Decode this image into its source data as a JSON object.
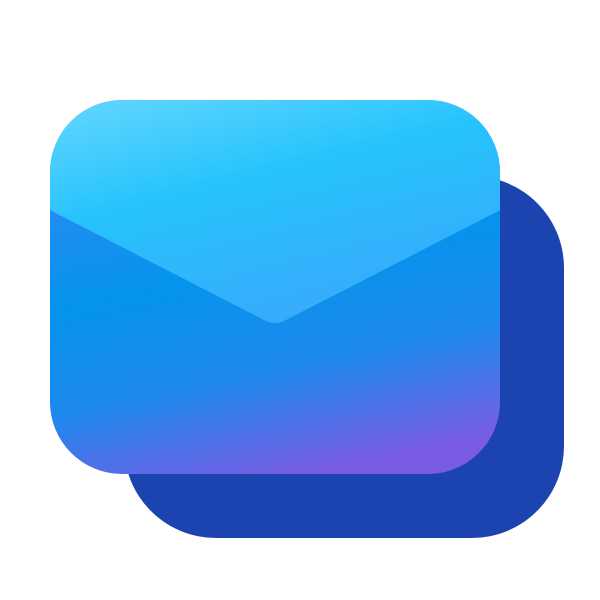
{
  "icon": {
    "name": "envelope-stack-icon",
    "colors": {
      "background": "#ffffff",
      "back_envelope": "#1c44b0",
      "body_top": "#3b86f3",
      "body_mid": "#0494ec",
      "body_bottom": "#7a5be3",
      "flap_top": "#5fd5fd",
      "flap_mid": "#26c3fd",
      "flap_bottom": "#3aa7fb"
    }
  }
}
